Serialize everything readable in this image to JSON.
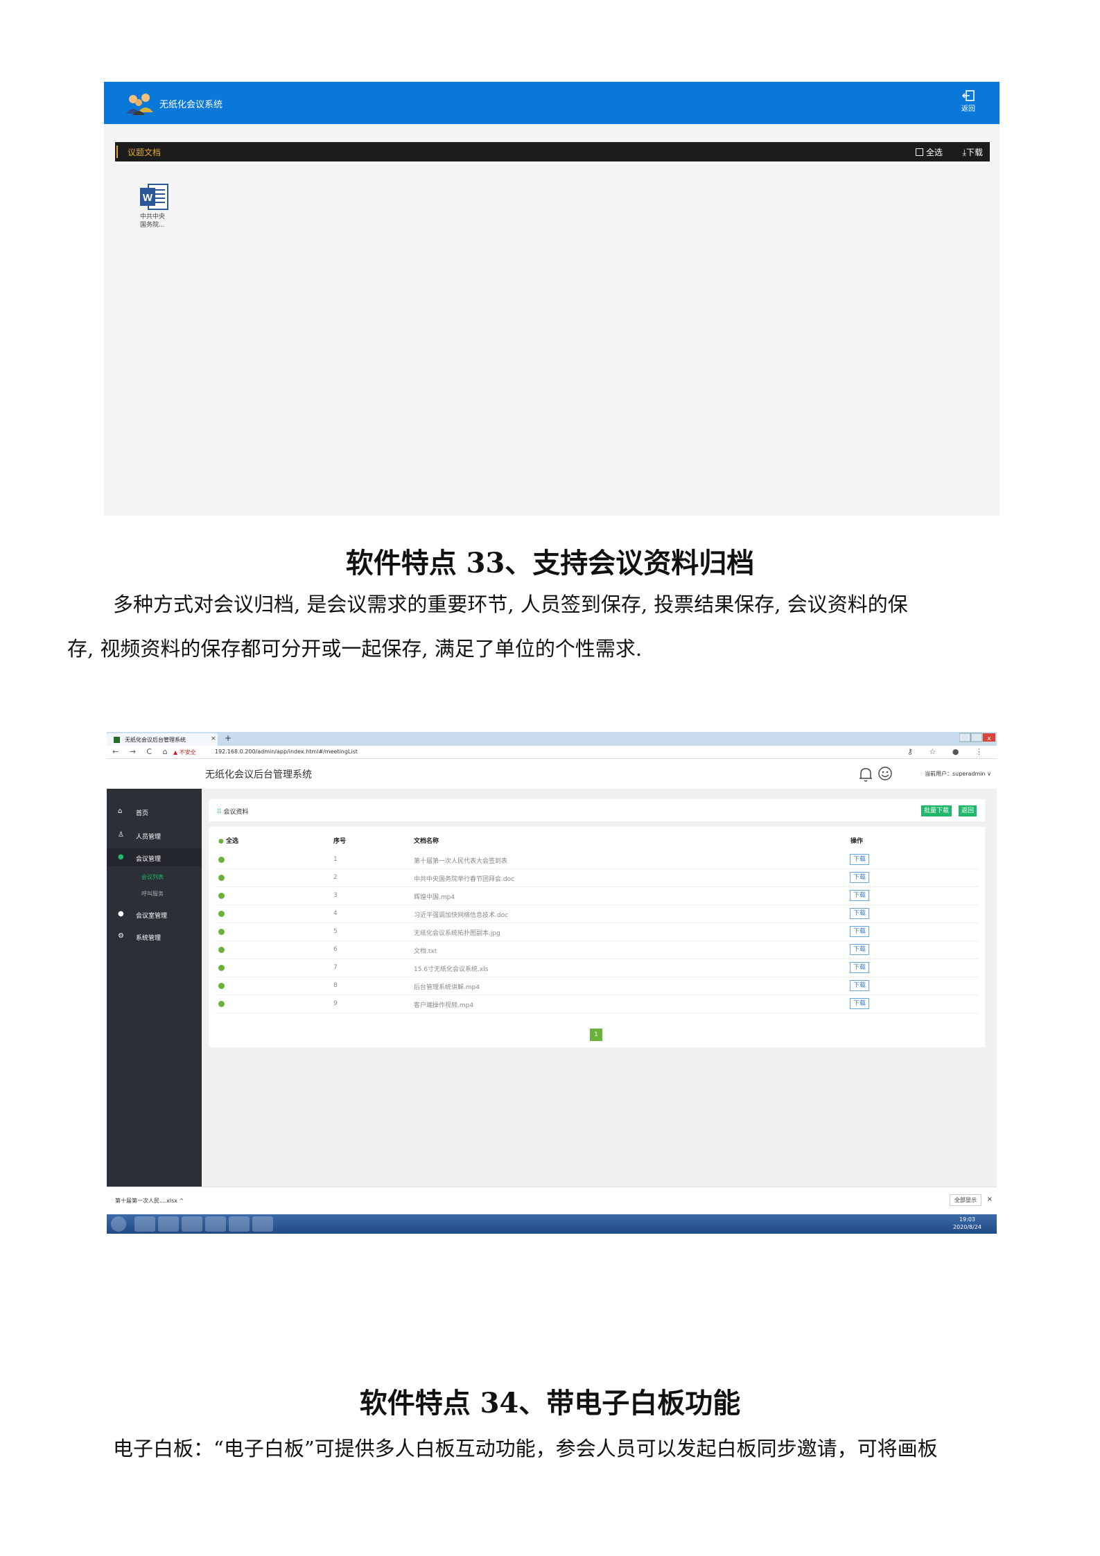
{
  "shot1": {
    "app_title": "无纸化会议系统",
    "back_label": "返回",
    "section_title": "议题文档",
    "select_all": "全选",
    "download": "下载",
    "file_name_line1": "中共中央",
    "file_name_line2": "国务院..."
  },
  "feature33": {
    "heading": "软件特点 33、支持会议资料归档",
    "para_line1": "多种方式对会议归档, 是会议需求的重要环节, 人员签到保存, 投票结果保存, 会议资料的保",
    "para_line2": "存, 视频资料的保存都可分开或一起保存, 满足了单位的个性需求."
  },
  "shot2": {
    "tab_label": "无纸化会议后台管理系统",
    "tab_close": "×",
    "new_tab": "+",
    "nav_icons": "← → C ⌂",
    "warning": "▲ 不安全",
    "url": "192.168.0.200/admin/app/index.html#/meetingList",
    "addr_right": "⚷ ☆ ● ⋮",
    "app_title": "无纸化会议后台管理系统",
    "current_user": "当前用户：superadmin ∨",
    "sidebar": {
      "home": "首页",
      "people": "人员管理",
      "meeting": "会议管理",
      "meeting_list": "会议列表",
      "call_service": "呼叫服务",
      "room": "会议室管理",
      "system": "系统管理"
    },
    "panel_title": "会议资料",
    "batch_download": "批量下载",
    "return": "返回",
    "headers": {
      "select_all": "全选",
      "index": "序号",
      "doc_name": "文档名称",
      "action": "操作"
    },
    "rows": [
      {
        "index": "1",
        "name": "第十届第一次人民代表大会签到表",
        "action": "下载"
      },
      {
        "index": "2",
        "name": "中共中央国务院举行春节团拜会.doc",
        "action": "下载"
      },
      {
        "index": "3",
        "name": "辉煌中国.mp4",
        "action": "下载"
      },
      {
        "index": "4",
        "name": "习近平强调加快网络信息技术.doc",
        "action": "下载"
      },
      {
        "index": "5",
        "name": "无纸化会议系统拓扑图副本.jpg",
        "action": "下载"
      },
      {
        "index": "6",
        "name": "文档.txt",
        "action": "下载"
      },
      {
        "index": "7",
        "name": "15.6寸无纸化会议系统.xls",
        "action": "下载"
      },
      {
        "index": "8",
        "name": "后台管理系统讲解.mp4",
        "action": "下载"
      },
      {
        "index": "9",
        "name": "客户端操作视频.mp4",
        "action": "下载"
      }
    ],
    "page_number": "1",
    "download_file": "第十届第一次人民....xlsx  ^",
    "show_all": "全部显示",
    "dl_close": "×",
    "clock_time": "19:03",
    "clock_date": "2020/8/24"
  },
  "feature34": {
    "heading": "软件特点 34、带电子白板功能",
    "para_line1": "电子白板：“电子白板”可提供多人白板互动功能，参会人员可以发起白板同步邀请，可将画板"
  }
}
